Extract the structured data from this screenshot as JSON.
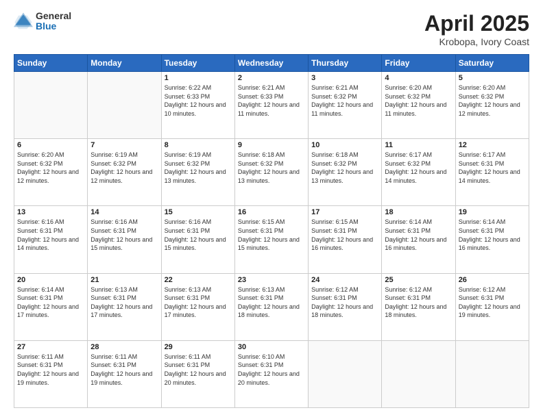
{
  "logo": {
    "general": "General",
    "blue": "Blue"
  },
  "header": {
    "title": "April 2025",
    "subtitle": "Krobopa, Ivory Coast"
  },
  "weekdays": [
    "Sunday",
    "Monday",
    "Tuesday",
    "Wednesday",
    "Thursday",
    "Friday",
    "Saturday"
  ],
  "weeks": [
    [
      {
        "day": "",
        "empty": true
      },
      {
        "day": "",
        "empty": true
      },
      {
        "day": "1",
        "sunrise": "Sunrise: 6:22 AM",
        "sunset": "Sunset: 6:33 PM",
        "daylight": "Daylight: 12 hours and 10 minutes."
      },
      {
        "day": "2",
        "sunrise": "Sunrise: 6:21 AM",
        "sunset": "Sunset: 6:33 PM",
        "daylight": "Daylight: 12 hours and 11 minutes."
      },
      {
        "day": "3",
        "sunrise": "Sunrise: 6:21 AM",
        "sunset": "Sunset: 6:32 PM",
        "daylight": "Daylight: 12 hours and 11 minutes."
      },
      {
        "day": "4",
        "sunrise": "Sunrise: 6:20 AM",
        "sunset": "Sunset: 6:32 PM",
        "daylight": "Daylight: 12 hours and 11 minutes."
      },
      {
        "day": "5",
        "sunrise": "Sunrise: 6:20 AM",
        "sunset": "Sunset: 6:32 PM",
        "daylight": "Daylight: 12 hours and 12 minutes."
      }
    ],
    [
      {
        "day": "6",
        "sunrise": "Sunrise: 6:20 AM",
        "sunset": "Sunset: 6:32 PM",
        "daylight": "Daylight: 12 hours and 12 minutes."
      },
      {
        "day": "7",
        "sunrise": "Sunrise: 6:19 AM",
        "sunset": "Sunset: 6:32 PM",
        "daylight": "Daylight: 12 hours and 12 minutes."
      },
      {
        "day": "8",
        "sunrise": "Sunrise: 6:19 AM",
        "sunset": "Sunset: 6:32 PM",
        "daylight": "Daylight: 12 hours and 13 minutes."
      },
      {
        "day": "9",
        "sunrise": "Sunrise: 6:18 AM",
        "sunset": "Sunset: 6:32 PM",
        "daylight": "Daylight: 12 hours and 13 minutes."
      },
      {
        "day": "10",
        "sunrise": "Sunrise: 6:18 AM",
        "sunset": "Sunset: 6:32 PM",
        "daylight": "Daylight: 12 hours and 13 minutes."
      },
      {
        "day": "11",
        "sunrise": "Sunrise: 6:17 AM",
        "sunset": "Sunset: 6:32 PM",
        "daylight": "Daylight: 12 hours and 14 minutes."
      },
      {
        "day": "12",
        "sunrise": "Sunrise: 6:17 AM",
        "sunset": "Sunset: 6:31 PM",
        "daylight": "Daylight: 12 hours and 14 minutes."
      }
    ],
    [
      {
        "day": "13",
        "sunrise": "Sunrise: 6:16 AM",
        "sunset": "Sunset: 6:31 PM",
        "daylight": "Daylight: 12 hours and 14 minutes."
      },
      {
        "day": "14",
        "sunrise": "Sunrise: 6:16 AM",
        "sunset": "Sunset: 6:31 PM",
        "daylight": "Daylight: 12 hours and 15 minutes."
      },
      {
        "day": "15",
        "sunrise": "Sunrise: 6:16 AM",
        "sunset": "Sunset: 6:31 PM",
        "daylight": "Daylight: 12 hours and 15 minutes."
      },
      {
        "day": "16",
        "sunrise": "Sunrise: 6:15 AM",
        "sunset": "Sunset: 6:31 PM",
        "daylight": "Daylight: 12 hours and 15 minutes."
      },
      {
        "day": "17",
        "sunrise": "Sunrise: 6:15 AM",
        "sunset": "Sunset: 6:31 PM",
        "daylight": "Daylight: 12 hours and 16 minutes."
      },
      {
        "day": "18",
        "sunrise": "Sunrise: 6:14 AM",
        "sunset": "Sunset: 6:31 PM",
        "daylight": "Daylight: 12 hours and 16 minutes."
      },
      {
        "day": "19",
        "sunrise": "Sunrise: 6:14 AM",
        "sunset": "Sunset: 6:31 PM",
        "daylight": "Daylight: 12 hours and 16 minutes."
      }
    ],
    [
      {
        "day": "20",
        "sunrise": "Sunrise: 6:14 AM",
        "sunset": "Sunset: 6:31 PM",
        "daylight": "Daylight: 12 hours and 17 minutes."
      },
      {
        "day": "21",
        "sunrise": "Sunrise: 6:13 AM",
        "sunset": "Sunset: 6:31 PM",
        "daylight": "Daylight: 12 hours and 17 minutes."
      },
      {
        "day": "22",
        "sunrise": "Sunrise: 6:13 AM",
        "sunset": "Sunset: 6:31 PM",
        "daylight": "Daylight: 12 hours and 17 minutes."
      },
      {
        "day": "23",
        "sunrise": "Sunrise: 6:13 AM",
        "sunset": "Sunset: 6:31 PM",
        "daylight": "Daylight: 12 hours and 18 minutes."
      },
      {
        "day": "24",
        "sunrise": "Sunrise: 6:12 AM",
        "sunset": "Sunset: 6:31 PM",
        "daylight": "Daylight: 12 hours and 18 minutes."
      },
      {
        "day": "25",
        "sunrise": "Sunrise: 6:12 AM",
        "sunset": "Sunset: 6:31 PM",
        "daylight": "Daylight: 12 hours and 18 minutes."
      },
      {
        "day": "26",
        "sunrise": "Sunrise: 6:12 AM",
        "sunset": "Sunset: 6:31 PM",
        "daylight": "Daylight: 12 hours and 19 minutes."
      }
    ],
    [
      {
        "day": "27",
        "sunrise": "Sunrise: 6:11 AM",
        "sunset": "Sunset: 6:31 PM",
        "daylight": "Daylight: 12 hours and 19 minutes."
      },
      {
        "day": "28",
        "sunrise": "Sunrise: 6:11 AM",
        "sunset": "Sunset: 6:31 PM",
        "daylight": "Daylight: 12 hours and 19 minutes."
      },
      {
        "day": "29",
        "sunrise": "Sunrise: 6:11 AM",
        "sunset": "Sunset: 6:31 PM",
        "daylight": "Daylight: 12 hours and 20 minutes."
      },
      {
        "day": "30",
        "sunrise": "Sunrise: 6:10 AM",
        "sunset": "Sunset: 6:31 PM",
        "daylight": "Daylight: 12 hours and 20 minutes."
      },
      {
        "day": "",
        "empty": true
      },
      {
        "day": "",
        "empty": true
      },
      {
        "day": "",
        "empty": true
      }
    ]
  ]
}
